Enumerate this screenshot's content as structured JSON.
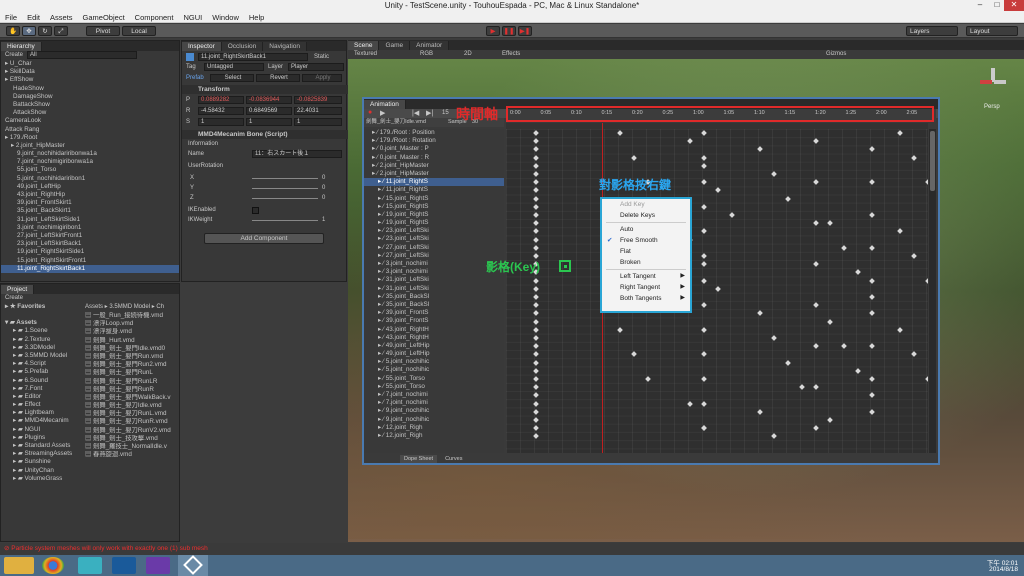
{
  "window": {
    "title": "Unity - TestScene.unity - TouhouEspada - PC, Mac & Linux Standalone*",
    "min": "–",
    "max": "□",
    "close": "✕"
  },
  "menu": [
    "File",
    "Edit",
    "Assets",
    "GameObject",
    "Component",
    "NGUI",
    "Window",
    "Help"
  ],
  "toolbar": {
    "pivot": "Pivot",
    "local": "Local",
    "layers": "Layers",
    "layout": "Layout"
  },
  "hierarchy": {
    "tab": "Hierarchy",
    "create": "Create",
    "search": "All",
    "items": [
      "U_Char",
      "SkillData",
      "EffShow",
      "HadeShow",
      "DamageShow",
      "BattackShow",
      "AttackShow",
      "CameraLook",
      "Attack Rang",
      "179./Root",
      "2.joint_HipMaster",
      "9.joint_nochihidariribonwa1a",
      "7.joint_nochimigiribonwa1a",
      "55.joint_Torso",
      "5.joint_nochihidariribon1",
      "49.joint_LeftHip",
      "43.joint_RightHip",
      "39.joint_FrontSkirt1",
      "35.joint_BackSkirt1",
      "31.joint_LeftSkirtSide1",
      "3.joint_nochimigiribon1",
      "27.joint_LeftSkirtFront1",
      "23.joint_LeftSkirtBack1",
      "19.joint_RightSkirtSide1",
      "15.joint_RightSkirtFront1",
      "11.joint_RightSkirtBack1"
    ]
  },
  "inspector": {
    "tabs": [
      "Inspector",
      "Occlusion",
      "Navigation"
    ],
    "object": "11.joint_RightSkirtBack1",
    "static": "Static",
    "tag_label": "Tag",
    "tag": "Untagged",
    "layer_label": "Layer",
    "layer": "Player",
    "prefab": "Prefab",
    "select": "Select",
    "revert": "Revert",
    "apply": "Apply",
    "transform": "Transform",
    "pos": [
      "0.0889282",
      "-0.0836944",
      "-0.0825839"
    ],
    "rot": [
      "-4.58432",
      "0.6849569",
      "22.4031"
    ],
    "scale": [
      "1",
      "1",
      "1"
    ],
    "script": "MMD4Mecanim Bone (Script)",
    "info": "Information",
    "name_label": "Name",
    "name": "11：右スカート後１",
    "user_rot": "UserRotation",
    "axes": [
      "X",
      "Y",
      "Z"
    ],
    "axis_vals": [
      "0",
      "0",
      "0"
    ],
    "ik_enabled": "IKEnabled",
    "ik_weight": "IKWeight",
    "ik_val": "1",
    "add": "Add Component"
  },
  "project": {
    "tab": "Project",
    "create": "Create",
    "favorites": "Favorites",
    "assets": "Assets",
    "folders": [
      "1.Scene",
      "2.Texture",
      "3.3DModel",
      "3.5MMD Model",
      "4.Script",
      "5.Prefab",
      "6.Sound",
      "7.Font",
      "Editor",
      "Effect",
      "Lightbeam",
      "MMD4Mecanim",
      "NGUI",
      "Plugins",
      "Standard Assets",
      "StreamingAssets",
      "Sunshine",
      "UnityChan",
      "VolumeGrass"
    ],
    "path": "Assets ▸ 3.5MMD Model ▸ Ch",
    "files": [
      "一般_Run_接続待機.vmd",
      "漂浮Loop.vmd",
      "漂浮拔身.vmd",
      "劍舞_Hurt.vmd",
      "劍舞_劍士_嬰門Idle.vmd0",
      "劍舞_劍士_嬰門Run.vmd",
      "劍舞_劍士_嬰門Run2.vmd",
      "劍舞_劍士_嬰門RunL",
      "劍舞_劍士_嬰門RunLR",
      "劍舞_劍士_嬰門RunR",
      "劍舞_劍士_嬰門WalkBack.v",
      "劍舞_劍士_嬰刀Idle.vmd",
      "劍舞_劍士_嬰刀RunL.vmd",
      "劍舞_劍士_嬰刀RunR.vmd",
      "劍舞_劍士_嬰刀RunV2.vmd",
      "劍舞_劍士_技攻擊.vmd",
      "劍舞_羅技士_NormalIdle.v",
      "春燕旋迴.vmd"
    ]
  },
  "scene": {
    "tabs": [
      "Scene",
      "Game",
      "Animator"
    ],
    "textured": "Textured",
    "rgb": "RGB",
    "twod": "2D",
    "effects": "Effects",
    "gizmos": "Gizmos",
    "persp": "Persp"
  },
  "animation": {
    "tab": "Animation",
    "clip": "劍舞_劍士_嬰刀Idle.vmd",
    "sample_label": "Sample",
    "sample": "30",
    "frame": "15",
    "time_ticks": [
      "0:00",
      "0:05",
      "0:10",
      "0:15",
      "0:20",
      "0:25",
      "1:00",
      "1:05",
      "1:10",
      "1:15",
      "1:20",
      "1:25",
      "2:00",
      "2:05"
    ],
    "props": [
      "179./Root : Position",
      "179./Root : Rotation",
      "0.joint_Master : P",
      "0.joint_Master : R",
      "2.joint_HipMaster",
      "2.joint_HipMaster",
      "11.joint_RightS",
      "11.joint_RightS",
      "15.joint_RightS",
      "15.joint_RightS",
      "19.joint_RightS",
      "19.joint_RightS",
      "23.joint_LeftSki",
      "23.joint_LeftSki",
      "27.joint_LeftSki",
      "27.joint_LeftSki",
      "3.joint_nochimi",
      "3.joint_nochimi",
      "31.joint_LeftSki",
      "31.joint_LeftSki",
      "35.joint_BackSl",
      "35.joint_BackSl",
      "39.joint_FrontS",
      "39.joint_FrontS",
      "43.joint_RightH",
      "43.joint_RightH",
      "49.joint_LeftHip",
      "49.joint_LeftHip",
      "5.joint_nochihic",
      "5.joint_nochihic",
      "55.joint_Torso",
      "55.joint_Torso",
      "7.joint_nochimi",
      "7.joint_nochimi",
      "9.joint_nochihic",
      "9.joint_nochihic",
      "12.joint_Righ",
      "12.joint_Righ"
    ],
    "bottom_tabs": [
      "Dope Sheet",
      "Curves"
    ]
  },
  "context_menu": {
    "items": [
      "Add Key",
      "Delete Keys",
      "Auto",
      "Free Smooth",
      "Flat",
      "Broken",
      "Left Tangent",
      "Right Tangent",
      "Both Tangents"
    ]
  },
  "annotations": {
    "timeline": "時間軸",
    "rightclick": "對影格按右鍵",
    "key": "影格(Key)"
  },
  "status": "Particle system meshes will only work with exactly one (1) sub mesh",
  "clock": {
    "time": "下午 02:01",
    "date": "2014/8/18"
  }
}
